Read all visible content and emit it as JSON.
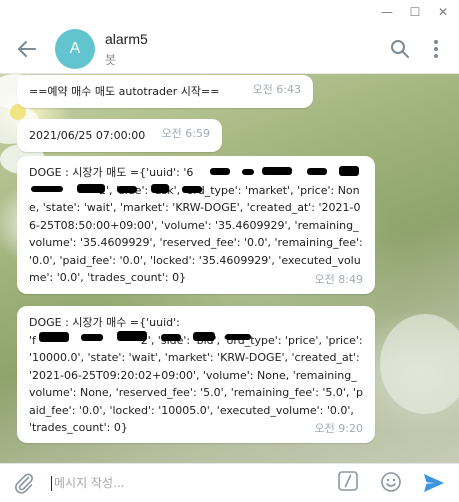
{
  "window": {
    "minimize": "—",
    "maximize": "☐",
    "close": "✕"
  },
  "header": {
    "avatar_letter": "A",
    "chat_name": "alarm5",
    "chat_sub": "봇"
  },
  "messages": [
    {
      "text": "==예약 매수 매도 autotrader 시작==",
      "time": "오전 6:43"
    },
    {
      "text": "2021/06/25 07:00:00",
      "time": "오전 6:59"
    },
    {
      "text": "DOGE : 시장가 매도 ={'uuid': '6                              \n                    2', 'side': 'ask', 'ord_type': 'market', 'price': None, 'state': 'wait', 'market': 'KRW-DOGE', 'created_at': '2021-06-25T08:50:00+09:00', 'volume': '35.4609929', 'remaining_volume': '35.4609929', 'reserved_fee': '0.0', 'remaining_fee': '0.0', 'paid_fee': '0.0', 'locked': '35.4609929', 'executed_volume': '0.0', 'trades_count': 0}",
      "time": "오전 8:49"
    },
    {
      "text": "DOGE : 시장가 매수 ={'uuid':\n'f                              2', 'side': 'bid', 'ord_type': 'price', 'price': '10000.0', 'state': 'wait', 'market': 'KRW-DOGE', 'created_at': '2021-06-25T09:20:02+09:00', 'volume': None, 'remaining_volume': None, 'reserved_fee': '5.0', 'remaining_fee': '5.0', 'paid_fee': '0.0', 'locked': '10005.0', 'executed_volume': '0.0', 'trades_count': 0}",
      "time": "오전 9:20"
    }
  ],
  "input": {
    "placeholder": "메시지 작성..."
  }
}
